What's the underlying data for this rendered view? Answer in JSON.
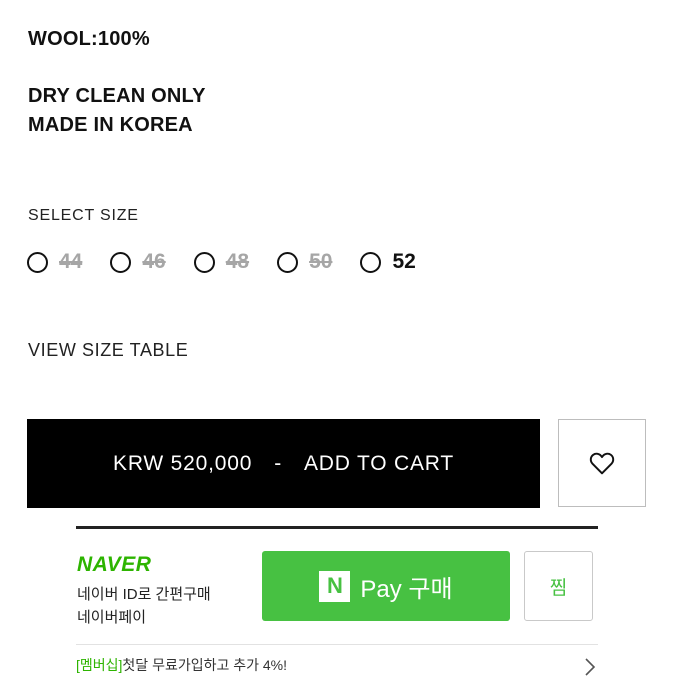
{
  "product": {
    "material": "WOOL:100%",
    "care": "DRY CLEAN ONLY",
    "origin": "MADE IN KOREA"
  },
  "size_selector": {
    "label": "SELECT SIZE",
    "options": [
      {
        "label": "44",
        "sold_out": true
      },
      {
        "label": "46",
        "sold_out": true
      },
      {
        "label": "48",
        "sold_out": true
      },
      {
        "label": "50",
        "sold_out": true
      },
      {
        "label": "52",
        "sold_out": false
      }
    ]
  },
  "view_size_table": "VIEW SIZE TABLE",
  "cart_button": {
    "price": "KRW 520,000",
    "separator": "-",
    "action": "ADD TO CART"
  },
  "wishlist": {
    "icon": "heart-icon"
  },
  "naver": {
    "logo": "NAVER",
    "desc_line1": "네이버 ID로 간편구매",
    "desc_line2": "네이버페이",
    "pay_badge": "N",
    "pay_label": "Pay 구매",
    "zzim_label": "찜",
    "promo_tag": "[멤버십]",
    "promo_text": "첫달 무료가입하고 추가 4%!",
    "brand_color": "#47c142"
  }
}
